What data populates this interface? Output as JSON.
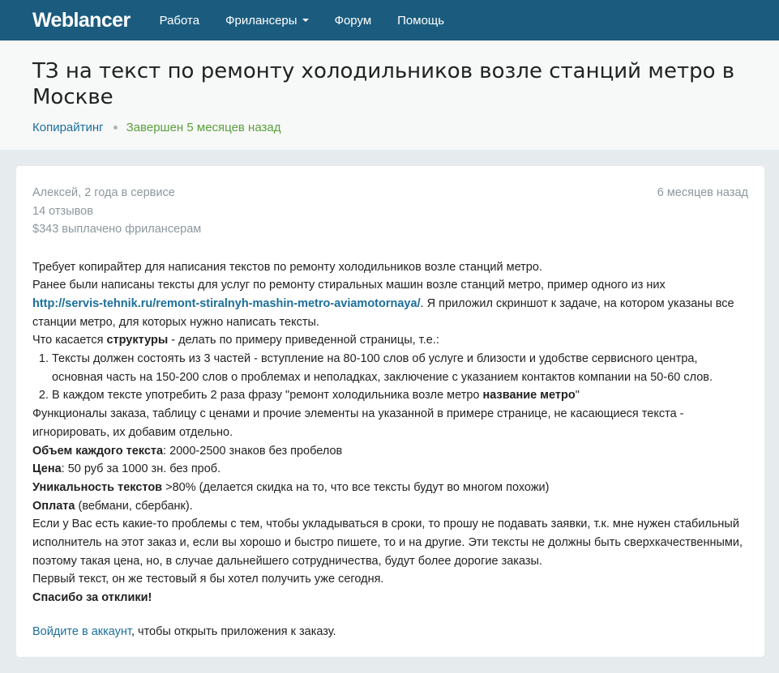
{
  "navbar": {
    "logo": "Weblancer",
    "items": [
      {
        "label": "Работа"
      },
      {
        "label": "Фрилансеры"
      },
      {
        "label": "Форум"
      },
      {
        "label": "Помощь"
      }
    ]
  },
  "header": {
    "title": "ТЗ на текст по ремонту холодильников возле станций метро в Москве",
    "category": "Копирайтинг",
    "status": "Завершен 5 месяцев назад"
  },
  "author": {
    "name_line": "Алексей, 2 года в сервисе",
    "reviews": "14 отзывов",
    "paid": "$343 выплачено фрилансерам",
    "posted": "6 месяцев назад"
  },
  "description": {
    "p1": "Требует копирайтер для написания текстов по ремонту холодильников возле станций метро.",
    "p2": "Ранее были написаны тексты для услуг по ремонту стиральных машин возле станций метро, пример одного из них",
    "link": "http://servis-tehnik.ru/remont-stiralnyh-mashin-metro-aviamotornaya/",
    "p2_after": ". Я приложил скриншот к задаче, на котором указаны все станции метро, для которых нужно написать тексты.",
    "struct_before": "Что касается ",
    "struct_bold": "структуры",
    "struct_after": " - делать по примеру приведенной страницы, т.е.:",
    "list_1": "Тексты должен состоять из 3 частей - вступление на 80-100 слов об услуге и близости и удобстве сервисного центра, основная часть на 150-200 слов о проблемах и неполадках, заключение с указанием контактов компании на 50-60 слов.",
    "list_2_before": "В каждом тексте употребить 2 раза фразу \"ремонт холодильника возле метро ",
    "list_2_bold": "название метро",
    "list_2_after": "\"",
    "func": "Функционалы заказа, таблицу с ценами и прочие элементы на указанной в примере странице, не касающиеся текста - игнорировать, их добавим отдельно.",
    "volume_label": "Объем каждого текста",
    "volume_value": ": 2000-2500 знаков без пробелов",
    "price_label": "Цена",
    "price_value": ": 50 руб за 1000 зн. без проб.",
    "unique_label": "Уникальность текстов",
    "unique_value": " >80% (делается скидка на то, что все тексты будут во многом похожи)",
    "payment_label": "Оплата",
    "payment_value": " (вебмани, сбербанк).",
    "p_problems": "Если у Вас есть какие-то проблемы с тем, чтобы укладываться в сроки, то прошу не подавать заявки, т.к. мне нужен стабильный исполнитель на этот заказ и, если вы хорошо и быстро пишете, то и на другие. Эти тексты не должны быть сверхкачественными, поэтому такая цена, но, в случае дальнейшего сотрудничества, будут более дорогие заказы.",
    "p_first": "Первый текст, он же тестовый я бы хотел получить уже сегодня.",
    "thanks": "Спасибо за отклики!"
  },
  "login": {
    "link": "Войдите в аккаунт",
    "rest": ", чтобы открыть приложения к заказу."
  }
}
